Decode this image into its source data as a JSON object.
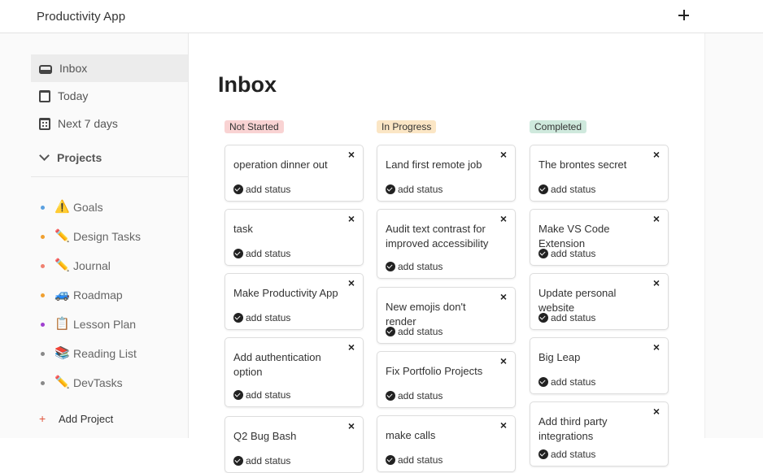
{
  "header": {
    "title": "Productivity App",
    "add_icon": "plus-icon"
  },
  "sidebar": {
    "nav": [
      {
        "label": "Inbox",
        "icon": "inbox-icon"
      },
      {
        "label": "Today",
        "icon": "calendar-icon"
      },
      {
        "label": "Next 7 days",
        "icon": "calendar-week-icon"
      }
    ],
    "projects_label": "Projects",
    "projects": [
      {
        "label": "Goals",
        "emoji": "⚠️",
        "dot_color": "#5aa0e0"
      },
      {
        "label": "Design Tasks",
        "emoji": "✏️",
        "dot_color": "#f0a030"
      },
      {
        "label": "Journal",
        "emoji": "✏️",
        "dot_color": "#f08070"
      },
      {
        "label": "Roadmap",
        "emoji": "🚙",
        "dot_color": "#f0a030"
      },
      {
        "label": "Lesson Plan",
        "emoji": "📋",
        "dot_color": "#a040d0"
      },
      {
        "label": "Reading List",
        "emoji": "📚",
        "dot_color": "#888888"
      },
      {
        "label": "DevTasks",
        "emoji": "✏️",
        "dot_color": "#888888"
      }
    ],
    "add_project_label": "Add Project"
  },
  "main": {
    "title": "Inbox",
    "status_label": "add status",
    "columns": [
      {
        "label": "Not Started",
        "color": "#f9d3d3",
        "cards": [
          "operation dinner out",
          "task",
          "Make Productivity App",
          "Add authentication option",
          "Q2 Bug Bash"
        ]
      },
      {
        "label": "In Progress",
        "color": "#fbe6c5",
        "cards": [
          "Land first remote job",
          "Audit text contrast for improved accessibility",
          "New emojis don't render",
          "Fix Portfolio Projects",
          "make calls"
        ]
      },
      {
        "label": "Completed",
        "color": "#cfe9dd",
        "cards": [
          "The brontes secret",
          "Make VS Code Extension",
          "Update personal website",
          "Big Leap",
          "Add third party integrations"
        ]
      }
    ]
  }
}
